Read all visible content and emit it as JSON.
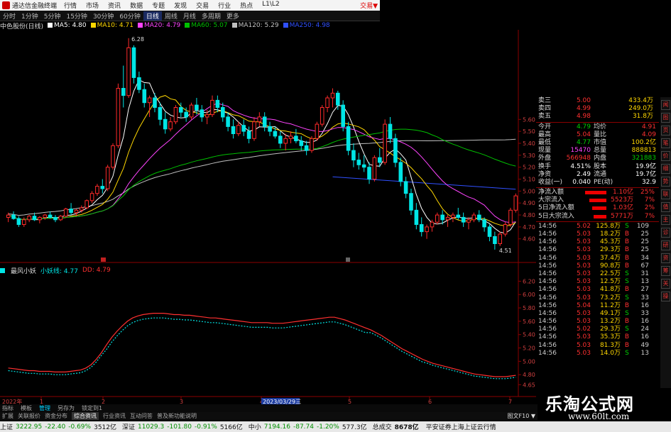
{
  "app": {
    "title": "通达信金融终端",
    "menu": [
      "行情",
      "市场",
      "资讯",
      "数据",
      "专题",
      "发现",
      "交易",
      "行业",
      "热点",
      "L1\\L2"
    ],
    "trade_label": "交易▼",
    "close_icon": "×"
  },
  "period_bar": {
    "items": [
      "分时",
      "1分钟",
      "5分钟",
      "15分钟",
      "30分钟",
      "60分钟",
      "日线",
      "周线",
      "月线",
      "多周期",
      "更多"
    ],
    "active": "日线"
  },
  "ma_legend": {
    "stock": "中色股份(日线)",
    "items": [
      {
        "label": "MA5: 4.80",
        "color": "#ffffff"
      },
      {
        "label": "MA10: 4.71",
        "color": "#ffd700"
      },
      {
        "label": "MA20: 4.79",
        "color": "#ff44ff"
      },
      {
        "label": "MA60: 5.07",
        "color": "#00c000"
      },
      {
        "label": "MA120: 5.29",
        "color": "#c0c0c0"
      },
      {
        "label": "MA250: 4.98",
        "color": "#3050ff"
      }
    ]
  },
  "indicator_legend": {
    "name": "最风小妖",
    "items": [
      {
        "label": "小妖线: 4.77",
        "color": "#00e5e5"
      },
      {
        "label": "DD: 4.79",
        "color": "#ff3030"
      }
    ]
  },
  "price_axis": [
    "5.60",
    "5.50",
    "5.40",
    "5.30",
    "5.20",
    "5.10",
    "5.00",
    "4.90",
    "4.80",
    "4.70",
    "4.60"
  ],
  "ind_axis": [
    "6.20",
    "6.00",
    "5.80",
    "5.60",
    "5.40",
    "5.20",
    "5.00",
    "4.80",
    "4.65"
  ],
  "annotations": {
    "high": "6.28",
    "low": "4.51"
  },
  "time_axis": {
    "year": "2022年",
    "labels": [
      "1",
      "2",
      "3",
      "4",
      "5",
      "6",
      "7"
    ],
    "cursor": "2023/03/29三"
  },
  "chart_data": {
    "type": "candlestick",
    "candles": [
      [
        4.78,
        4.82,
        4.74,
        4.8
      ],
      [
        4.8,
        4.83,
        4.76,
        4.77
      ],
      [
        4.77,
        4.79,
        4.7,
        4.72
      ],
      [
        4.72,
        4.78,
        4.7,
        4.76
      ],
      [
        4.76,
        4.8,
        4.74,
        4.79
      ],
      [
        4.79,
        4.82,
        4.75,
        4.76
      ],
      [
        4.76,
        4.79,
        4.73,
        4.78
      ],
      [
        4.78,
        4.81,
        4.76,
        4.8
      ],
      [
        4.8,
        4.83,
        4.77,
        4.78
      ],
      [
        4.78,
        4.8,
        4.74,
        4.76
      ],
      [
        4.76,
        4.8,
        4.75,
        4.79
      ],
      [
        4.79,
        4.86,
        4.78,
        4.85
      ],
      [
        4.85,
        4.9,
        4.8,
        4.82
      ],
      [
        4.82,
        4.85,
        4.79,
        4.84
      ],
      [
        4.84,
        4.88,
        4.82,
        4.86
      ],
      [
        4.86,
        4.93,
        4.85,
        4.92
      ],
      [
        4.92,
        5.0,
        4.9,
        4.98
      ],
      [
        4.98,
        5.06,
        4.96,
        5.04
      ],
      [
        5.04,
        5.1,
        4.98,
        5.02
      ],
      [
        5.02,
        5.22,
        5.0,
        5.2
      ],
      [
        5.2,
        5.4,
        5.18,
        5.38
      ],
      [
        5.38,
        5.9,
        5.36,
        5.86
      ],
      [
        5.86,
        6.05,
        5.7,
        5.8
      ],
      [
        5.8,
        6.28,
        5.78,
        6.2
      ],
      [
        6.2,
        6.22,
        5.9,
        5.95
      ],
      [
        5.95,
        6.0,
        5.82,
        5.85
      ],
      [
        5.85,
        5.9,
        5.7,
        5.74
      ],
      [
        5.74,
        5.8,
        5.62,
        5.78
      ],
      [
        5.78,
        5.82,
        5.66,
        5.7
      ],
      [
        5.7,
        5.74,
        5.55,
        5.6
      ],
      [
        5.6,
        5.66,
        5.48,
        5.52
      ],
      [
        5.52,
        5.62,
        5.5,
        5.58
      ],
      [
        5.58,
        5.72,
        5.56,
        5.7
      ],
      [
        5.7,
        5.74,
        5.62,
        5.66
      ],
      [
        5.66,
        5.7,
        5.58,
        5.62
      ],
      [
        5.62,
        5.74,
        5.6,
        5.72
      ],
      [
        5.72,
        5.78,
        5.64,
        5.68
      ],
      [
        5.68,
        5.72,
        5.58,
        5.62
      ],
      [
        5.62,
        5.68,
        5.56,
        5.64
      ],
      [
        5.64,
        5.8,
        5.62,
        5.76
      ],
      [
        5.76,
        5.8,
        5.66,
        5.7
      ],
      [
        5.7,
        5.74,
        5.58,
        5.62
      ],
      [
        5.62,
        5.66,
        5.5,
        5.54
      ],
      [
        5.54,
        5.6,
        5.44,
        5.48
      ],
      [
        5.48,
        5.58,
        5.46,
        5.55
      ],
      [
        5.55,
        5.6,
        5.46,
        5.5
      ],
      [
        5.5,
        5.54,
        5.4,
        5.44
      ],
      [
        5.44,
        5.62,
        5.42,
        5.58
      ],
      [
        5.58,
        5.66,
        5.54,
        5.62
      ],
      [
        5.62,
        5.66,
        5.5,
        5.54
      ],
      [
        5.54,
        5.58,
        5.46,
        5.5
      ],
      [
        5.5,
        5.54,
        5.44,
        5.46
      ],
      [
        5.46,
        5.5,
        5.36,
        5.4
      ],
      [
        5.4,
        5.48,
        5.34,
        5.44
      ],
      [
        5.44,
        5.5,
        5.4,
        5.46
      ],
      [
        5.46,
        5.52,
        5.4,
        5.42
      ],
      [
        5.42,
        5.46,
        5.34,
        5.38
      ],
      [
        5.38,
        5.42,
        5.3,
        5.34
      ],
      [
        5.34,
        5.46,
        5.32,
        5.44
      ],
      [
        5.44,
        5.58,
        5.42,
        5.56
      ],
      [
        5.56,
        5.72,
        5.54,
        5.7
      ],
      [
        5.7,
        5.8,
        5.66,
        5.78
      ],
      [
        5.78,
        5.86,
        5.7,
        5.82
      ],
      [
        5.82,
        5.84,
        5.68,
        5.72
      ],
      [
        5.72,
        5.76,
        5.5,
        5.54
      ],
      [
        5.54,
        5.58,
        5.3,
        5.34
      ],
      [
        5.34,
        5.4,
        5.2,
        5.26
      ],
      [
        5.26,
        5.32,
        5.18,
        5.22
      ],
      [
        5.22,
        5.3,
        5.16,
        5.2
      ],
      [
        5.2,
        5.24,
        5.06,
        5.1
      ],
      [
        5.1,
        5.3,
        5.08,
        5.28
      ],
      [
        5.28,
        5.36,
        5.2,
        5.24
      ],
      [
        5.24,
        5.6,
        5.22,
        5.56
      ],
      [
        5.56,
        5.62,
        5.4,
        5.44
      ],
      [
        5.44,
        5.48,
        5.2,
        5.24
      ],
      [
        5.24,
        5.28,
        5.04,
        5.08
      ],
      [
        5.08,
        5.12,
        4.94,
        4.98
      ],
      [
        4.98,
        5.02,
        4.8,
        4.84
      ],
      [
        4.84,
        4.9,
        4.68,
        4.72
      ],
      [
        4.72,
        4.78,
        4.62,
        4.66
      ],
      [
        4.66,
        4.72,
        4.6,
        4.7
      ],
      [
        4.7,
        4.76,
        4.66,
        4.74
      ],
      [
        4.74,
        4.82,
        4.72,
        4.8
      ],
      [
        4.8,
        4.84,
        4.72,
        4.76
      ],
      [
        4.76,
        4.8,
        4.7,
        4.78
      ],
      [
        4.78,
        4.82,
        4.74,
        4.8
      ],
      [
        4.8,
        4.86,
        4.76,
        4.78
      ],
      [
        4.78,
        4.82,
        4.7,
        4.74
      ],
      [
        4.74,
        4.78,
        4.68,
        4.76
      ],
      [
        4.76,
        4.82,
        4.74,
        4.8
      ],
      [
        4.8,
        4.84,
        4.74,
        4.76
      ],
      [
        4.76,
        4.78,
        4.66,
        4.7
      ],
      [
        4.7,
        4.72,
        4.58,
        4.62
      ],
      [
        4.62,
        4.66,
        4.51,
        4.56
      ],
      [
        4.56,
        4.66,
        4.54,
        4.64
      ],
      [
        4.64,
        4.74,
        4.62,
        4.72
      ],
      [
        4.72,
        4.86,
        4.7,
        4.84
      ],
      [
        4.84,
        4.98,
        4.82,
        4.96
      ]
    ]
  },
  "indicator": {
    "dd": [
      4.9,
      4.89,
      4.88,
      4.87,
      4.86,
      4.86,
      4.85,
      4.85,
      4.85,
      4.84,
      4.84,
      4.84,
      4.85,
      4.86,
      4.87,
      4.9,
      4.95,
      5.03,
      5.13,
      5.25,
      5.36,
      5.45,
      5.53,
      5.6,
      5.65,
      5.68,
      5.7,
      5.71,
      5.72,
      5.72,
      5.72,
      5.71,
      5.7,
      5.7,
      5.69,
      5.69,
      5.68,
      5.67,
      5.66,
      5.65,
      5.65,
      5.64,
      5.63,
      5.62,
      5.61,
      5.6,
      5.59,
      5.58,
      5.58,
      5.58,
      5.58,
      5.57,
      5.57,
      5.57,
      5.58,
      5.59,
      5.6,
      5.61,
      5.62,
      5.63,
      5.64,
      5.65,
      5.66,
      5.66,
      5.64,
      5.62,
      5.59,
      5.56,
      5.53,
      5.5,
      5.47,
      5.43,
      5.39,
      5.34,
      5.29,
      5.24,
      5.19,
      5.15,
      5.11,
      5.07,
      5.03,
      5.0,
      4.97,
      4.95,
      4.93,
      4.91,
      4.89,
      4.87,
      4.85,
      4.83,
      4.81,
      4.8,
      4.79,
      4.78,
      4.77,
      4.77,
      4.77,
      4.78,
      4.79
    ]
  },
  "right_panel": {
    "quotes": [
      {
        "l": "卖三",
        "p": "5.00",
        "v": "433.4万",
        "pc": "up"
      },
      {
        "l": "卖四",
        "p": "4.99",
        "v": "249.0万",
        "pc": "up"
      },
      {
        "l": "卖五",
        "p": "4.98",
        "v": "31.8万",
        "pc": "up"
      }
    ],
    "stats": [
      {
        "a": "今开",
        "b": "4.79",
        "bc": "dn",
        "c": "均价",
        "d": "4.91",
        "dc": "up"
      },
      {
        "a": "最高",
        "b": "5.04",
        "bc": "up",
        "c": "量比",
        "d": "4.09",
        "dc": "up"
      },
      {
        "a": "最低",
        "b": "4.77",
        "bc": "dn",
        "c": "市值",
        "d": "100.2亿",
        "dc": "yel"
      },
      {
        "a": "现量",
        "b": "15470",
        "bc": "mag",
        "c": "总量",
        "d": "888813",
        "dc": "yel"
      },
      {
        "a": "外盘",
        "b": "566948",
        "bc": "up",
        "c": "内盘",
        "d": "321883",
        "dc": "dn"
      },
      {
        "a": "换手",
        "b": "4.51%",
        "bc": "white",
        "c": "股本",
        "d": "19.9亿",
        "dc": "white"
      },
      {
        "a": "净资",
        "b": "2.49",
        "bc": "white",
        "c": "流通",
        "d": "19.7亿",
        "dc": "white"
      },
      {
        "a": "收益(一)",
        "b": "0.040",
        "bc": "white",
        "c": "PE(动)",
        "d": "32.9",
        "dc": "white"
      }
    ],
    "flows": [
      {
        "l": "净流入额",
        "w": 30,
        "v": "1.10亿",
        "p": "25%"
      },
      {
        "l": "大宗流入",
        "w": 24,
        "v": "5523万",
        "p": "7%"
      },
      {
        "l": "5日净流入额",
        "w": 20,
        "v": "1.03亿",
        "p": "2%"
      },
      {
        "l": "5日大宗流入",
        "w": 18,
        "v": "5771万",
        "p": "7%"
      }
    ],
    "trades": [
      {
        "t": "14:56",
        "p": "5.02",
        "v": "125.8万",
        "bs": "S",
        "n": "109"
      },
      {
        "t": "14:56",
        "p": "5.03",
        "v": "18.2万",
        "bs": "B",
        "n": "25"
      },
      {
        "t": "14:56",
        "p": "5.03",
        "v": "45.3万",
        "bs": "B",
        "n": "25"
      },
      {
        "t": "14:56",
        "p": "5.03",
        "v": "29.3万",
        "bs": "B",
        "n": "25"
      },
      {
        "t": "14:56",
        "p": "5.03",
        "v": "37.4万",
        "bs": "B",
        "n": "34"
      },
      {
        "t": "14:56",
        "p": "5.03",
        "v": "90.8万",
        "bs": "B",
        "n": "67"
      },
      {
        "t": "14:56",
        "p": "5.03",
        "v": "22.5万",
        "bs": "S",
        "n": "31"
      },
      {
        "t": "14:56",
        "p": "5.03",
        "v": "12.5万",
        "bs": "S",
        "n": "13"
      },
      {
        "t": "14:56",
        "p": "5.03",
        "v": "41.8万",
        "bs": "B",
        "n": "27"
      },
      {
        "t": "14:56",
        "p": "5.03",
        "v": "73.2万",
        "bs": "S",
        "n": "33"
      },
      {
        "t": "14:56",
        "p": "5.04",
        "v": "11.2万",
        "bs": "B",
        "n": "16"
      },
      {
        "t": "14:56",
        "p": "5.03",
        "v": "49.1万",
        "bs": "S",
        "n": "33"
      },
      {
        "t": "14:56",
        "p": "5.03",
        "v": "13.2万",
        "bs": "B",
        "n": "16"
      },
      {
        "t": "14:56",
        "p": "5.02",
        "v": "29.3万",
        "bs": "S",
        "n": "24"
      },
      {
        "t": "14:56",
        "p": "5.03",
        "v": "35.3万",
        "bs": "B",
        "n": "16"
      },
      {
        "t": "14:56",
        "p": "5.03",
        "v": "81.3万",
        "bs": "B",
        "n": "49"
      },
      {
        "t": "14:56",
        "p": "5.03",
        "v": "14.0万",
        "bs": "S",
        "n": "13"
      }
    ],
    "side_icons": [
      "闻",
      "图",
      "页",
      "笔",
      "价",
      "细",
      "势",
      "联",
      "值",
      "主",
      "诊",
      "研",
      "资",
      "筹",
      "关",
      "操"
    ]
  },
  "bottom_tabs": {
    "row1": [
      "指标",
      "模板",
      "管理",
      "另存为",
      "锁定到1"
    ],
    "row1_active": "管理",
    "row2": [
      "扩展",
      "关联报价",
      "资金分布",
      "综合资讯",
      "行业资讯",
      "互动问答",
      "普及新功能说明"
    ],
    "row2_active": "综合资讯",
    "info_label": "图文F10 ▼"
  },
  "status_bar": {
    "items": [
      {
        "n": "上证",
        "v": "3222.95",
        "c": "-22.40",
        "p": "-0.69%",
        "a": "3512亿"
      },
      {
        "n": "深证",
        "v": "11029.3",
        "c": "-101.80",
        "p": "-0.91%",
        "a": "5166亿"
      },
      {
        "n": "中小",
        "v": "7194.16",
        "c": "-87.74",
        "p": "-1.20%",
        "a": "577.3亿"
      }
    ],
    "total_label": "总成交",
    "total_value": "8678亿",
    "broker": "平安证券上海上证云行情"
  },
  "watermark": {
    "line1": "乐淘公式网",
    "line2": "www.60lt.com"
  }
}
